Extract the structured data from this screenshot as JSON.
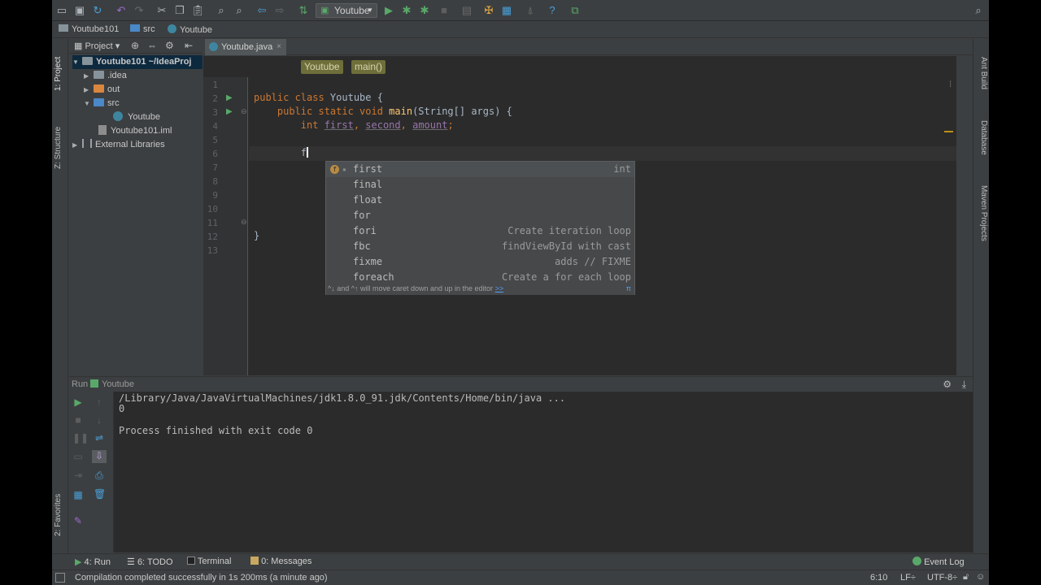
{
  "toolbar": {
    "run_config": "Youtube",
    "icons": [
      "open-icon",
      "save-icon",
      "sync-icon",
      "undo-icon",
      "redo-icon",
      "cut-icon",
      "copy-icon",
      "paste-icon",
      "find-icon",
      "replace-icon",
      "back-icon",
      "forward-icon",
      "build-icon",
      "run-icon",
      "debug-icon",
      "coverage-icon",
      "stop-icon",
      "project-structure-icon",
      "settings-icon",
      "sdk-icon",
      "help-icon",
      "vcs-icon",
      "search-icon"
    ]
  },
  "navbar": {
    "crumbs": [
      "Youtube101",
      "src",
      "Youtube"
    ]
  },
  "left_stripe": {
    "project_tab": "1: Project",
    "structure_tab": "Z: Structure",
    "favorites_tab": "2: Favorites"
  },
  "project_panel": {
    "header_label": "Project",
    "tree": [
      {
        "label": "Youtube101 ~/IdeaProj",
        "type": "module",
        "depth": 0,
        "expanded": true,
        "bold": true
      },
      {
        "label": ".idea",
        "type": "folder",
        "depth": 1,
        "expanded": false
      },
      {
        "label": "out",
        "type": "folder-orange",
        "depth": 1,
        "expanded": false
      },
      {
        "label": "src",
        "type": "folder-blue",
        "depth": 1,
        "expanded": true
      },
      {
        "label": "Youtube",
        "type": "class",
        "depth": 2
      },
      {
        "label": "Youtube101.iml",
        "type": "file",
        "depth": 1
      },
      {
        "label": "External Libraries",
        "type": "libraries",
        "depth": 0,
        "expanded": false
      }
    ]
  },
  "editor": {
    "tab_label": "Youtube.java",
    "breadcrumb_class": "Youtube",
    "breadcrumb_method": "main()",
    "line_numbers": [
      "1",
      "2",
      "3",
      "4",
      "5",
      "6",
      "7",
      "8",
      "9",
      "10",
      "11",
      "12",
      "13"
    ],
    "code": {
      "line2_kw": "public class ",
      "line2_name": "Youtube",
      "line2_rest": " {",
      "line3_kw": "    public static void ",
      "line3_name": "main",
      "line3_rest": "(String[] args) {",
      "line4_kw": "        int ",
      "line4_v1": "first",
      "line4_sep1": ", ",
      "line4_v2": "second",
      "line4_sep2": ", ",
      "line4_v3": "amount",
      "line4_end": ";",
      "line6_typed": "        f",
      "line12": "}"
    }
  },
  "completion": {
    "items": [
      {
        "name": "first",
        "tail": "int"
      },
      {
        "name": "final",
        "tail": ""
      },
      {
        "name": "float",
        "tail": ""
      },
      {
        "name": "for",
        "tail": ""
      },
      {
        "name": "fori",
        "tail": "Create iteration loop"
      },
      {
        "name": "fbc",
        "tail": "findViewById with cast"
      },
      {
        "name": "fixme",
        "tail": "adds // FIXME"
      },
      {
        "name": "foreach",
        "tail": "Create a for each loop"
      }
    ],
    "hint": "^↓ and ^↑ will move caret down and up in the editor",
    "hint_link": ">>",
    "pi": "π"
  },
  "right_stripe": {
    "ant_build": "Ant Build",
    "database": "Database",
    "maven": "Maven Projects"
  },
  "run_panel": {
    "title": "Run",
    "config": "Youtube",
    "output": [
      "/Library/Java/JavaVirtualMachines/jdk1.8.0_91.jdk/Contents/Home/bin/java ...",
      "0",
      "",
      "Process finished with exit code 0"
    ]
  },
  "tool_windows": {
    "run": "4: Run",
    "todo": "6: TODO",
    "terminal": "Terminal",
    "messages": "0: Messages",
    "event_log": "Event Log"
  },
  "status": {
    "message": "Compilation completed successfully in 1s 200ms (a minute ago)",
    "position": "6:10",
    "line_sep": "LF÷",
    "encoding": "UTF-8÷"
  },
  "colors": {
    "background": "#3c3f41",
    "editor_bg": "#2b2b2b",
    "keyword": "#cc7832",
    "method": "#ffc66d",
    "field": "#9876aa",
    "run_green": "#59a869"
  }
}
